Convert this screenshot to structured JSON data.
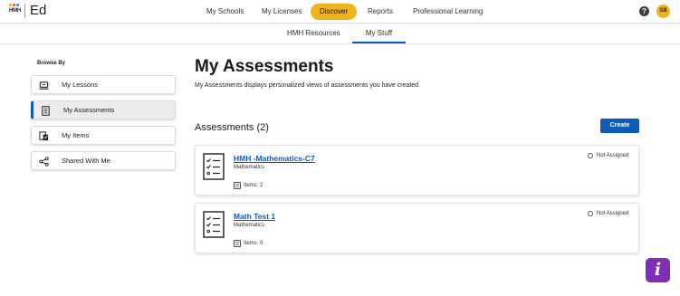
{
  "brand": {
    "logo_text": "HMH",
    "app_name": "Ed",
    "dot_colors": [
      "#f2b21b",
      "#e5403a",
      "#1c8cd6"
    ]
  },
  "main_nav": [
    "My Schools",
    "My Licenses",
    "Discover",
    "Reports",
    "Professional Learning"
  ],
  "main_nav_active": "Discover",
  "header_icons": {
    "help": "help-icon",
    "help_glyph": "?",
    "avatar_initials": "SB"
  },
  "sub_nav": [
    "HMH Resources",
    "My Stuff"
  ],
  "sub_nav_active": "My Stuff",
  "browse": {
    "label": "Browse By",
    "items": [
      {
        "label": "My Lessons",
        "icon": "lessons-icon"
      },
      {
        "label": "My Assessments",
        "icon": "assessments-icon"
      },
      {
        "label": "My Items",
        "icon": "items-icon"
      },
      {
        "label": "Shared With Me",
        "icon": "share-icon"
      }
    ],
    "active": "My Assessments"
  },
  "page": {
    "title": "My Assessments",
    "description": "My Assessments displays personalized views of assessments you have created.",
    "section_title": "Assessments (2)",
    "create_label": "Create"
  },
  "assessments": [
    {
      "title": "HMH -Mathematics-C7",
      "subject": "Mathematics",
      "items": "Items: 2",
      "status": "Not Assigned"
    },
    {
      "title": "Math Test 1",
      "subject": "Mathematics",
      "items": "Items: 0",
      "status": "Not Assigned"
    }
  ],
  "info_button": {
    "glyph": "i"
  },
  "colors": {
    "accent": "#f2b21b",
    "primary": "#0b5cb8",
    "info": "#7d2fb8"
  }
}
